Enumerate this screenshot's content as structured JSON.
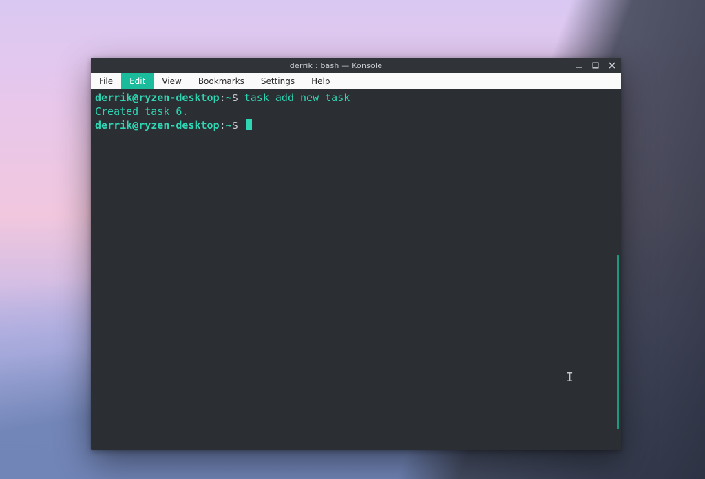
{
  "window": {
    "title": "derrik : bash — Konsole"
  },
  "menu": {
    "items": [
      {
        "label": "File",
        "active": false
      },
      {
        "label": "Edit",
        "active": true
      },
      {
        "label": "View",
        "active": false
      },
      {
        "label": "Bookmarks",
        "active": false
      },
      {
        "label": "Settings",
        "active": false
      },
      {
        "label": "Help",
        "active": false
      }
    ]
  },
  "terminal": {
    "prompt_user_host": "derrik@ryzen-desktop",
    "prompt_sep": ":",
    "prompt_path": "~",
    "prompt_symbol": "$",
    "lines": {
      "l1_command": "task add new task",
      "l2_output": "Created task 6."
    }
  },
  "colors": {
    "accent": "#1abc9c",
    "terminal_bg": "#2b2f33",
    "terminal_fg": "#d7dbdf",
    "prompt_fg": "#2fd6b4"
  }
}
